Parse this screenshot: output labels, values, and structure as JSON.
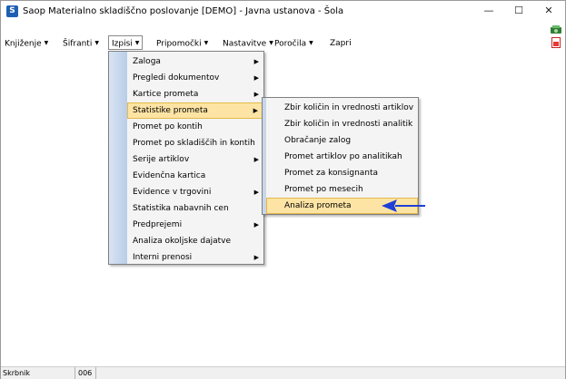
{
  "window": {
    "title": "Saop  Materialno skladiščno poslovanje [DEMO] - Javna ustanova - Šola",
    "app_icon_letter": "S",
    "controls": {
      "minimize": "—",
      "maximize": "☐",
      "close": "✕"
    }
  },
  "menubar": {
    "items": [
      {
        "label": "Knjiženje",
        "caret": "▼"
      },
      {
        "label": "Šifranti",
        "caret": "▼"
      },
      {
        "label": "Izpisi",
        "caret": "▼"
      },
      {
        "label": "Pripomočki",
        "caret": "▼"
      },
      {
        "label": "Nastavitve",
        "caret": "▼"
      },
      {
        "label": "Poročila",
        "caret": "▼"
      },
      {
        "label": "Zapri",
        "caret": ""
      }
    ]
  },
  "izpisi_menu": {
    "arrow_glyph": "▶",
    "items": [
      {
        "label": "Zaloga",
        "has_submenu": true
      },
      {
        "label": "Pregledi dokumentov",
        "has_submenu": true
      },
      {
        "label": "Kartice prometa",
        "has_submenu": true
      },
      {
        "label": "Statistike prometa",
        "has_submenu": true,
        "highlighted": true
      },
      {
        "label": "Promet po kontih",
        "has_submenu": false
      },
      {
        "label": "Promet po skladiščih in kontih",
        "has_submenu": false
      },
      {
        "label": "Serije artiklov",
        "has_submenu": true
      },
      {
        "label": "Evidenčna kartica",
        "has_submenu": false
      },
      {
        "label": "Evidence v trgovini",
        "has_submenu": true
      },
      {
        "label": "Statistika nabavnih cen",
        "has_submenu": false
      },
      {
        "label": "Predprejemi",
        "has_submenu": true
      },
      {
        "label": "Analiza okoljske dajatve",
        "has_submenu": false
      },
      {
        "label": "Interni prenosi",
        "has_submenu": true
      }
    ]
  },
  "statistike_submenu": {
    "items": [
      {
        "label": "Zbir količin in vrednosti artiklov"
      },
      {
        "label": "Zbir količin in vrednosti analitik"
      },
      {
        "label": "Obračanje zalog"
      },
      {
        "label": "Promet artiklov po analitikah"
      },
      {
        "label": "Promet za konsignanta"
      },
      {
        "label": "Promet po mesecih"
      },
      {
        "label": "Analiza prometa",
        "highlighted": true
      }
    ]
  },
  "statusbar": {
    "user": "Skrbnik",
    "code": "006"
  },
  "colors": {
    "highlight_bg": "#fde4a4",
    "highlight_border": "#e3b94a",
    "pointer_arrow": "#1f3fd6",
    "side_strip": "#b9cde8"
  }
}
